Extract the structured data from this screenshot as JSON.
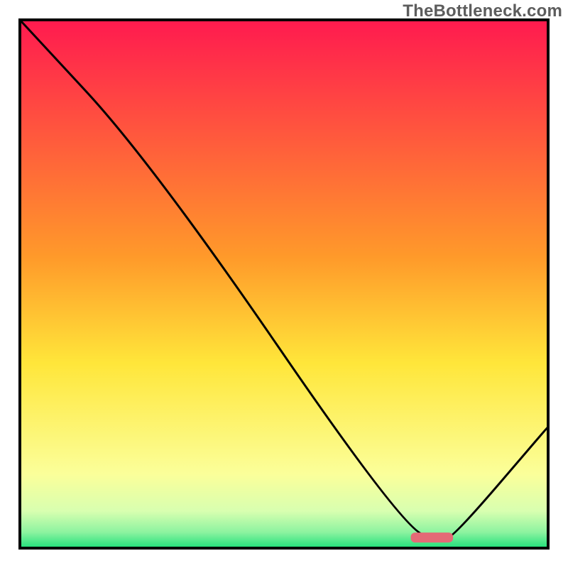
{
  "watermark": "TheBottleneck.com",
  "chart_data": {
    "type": "line",
    "title": "",
    "xlabel": "",
    "ylabel": "",
    "xlim": [
      0,
      100
    ],
    "ylim": [
      0,
      100
    ],
    "x": [
      0,
      25,
      73,
      80,
      82,
      100
    ],
    "values": [
      100,
      73,
      3,
      2,
      2,
      23
    ],
    "marker": {
      "x_start": 74,
      "x_end": 82,
      "y": 2,
      "color": "#e46a76"
    },
    "gradient_stops": [
      {
        "offset": 0,
        "color": "#ff1a4f"
      },
      {
        "offset": 45,
        "color": "#ff9a2a"
      },
      {
        "offset": 65,
        "color": "#ffe63a"
      },
      {
        "offset": 86,
        "color": "#fbff9a"
      },
      {
        "offset": 93,
        "color": "#d8ffb0"
      },
      {
        "offset": 97,
        "color": "#8cf3a0"
      },
      {
        "offset": 100,
        "color": "#1fe07a"
      }
    ],
    "frame_color": "#000000",
    "line_color": "#000000"
  }
}
